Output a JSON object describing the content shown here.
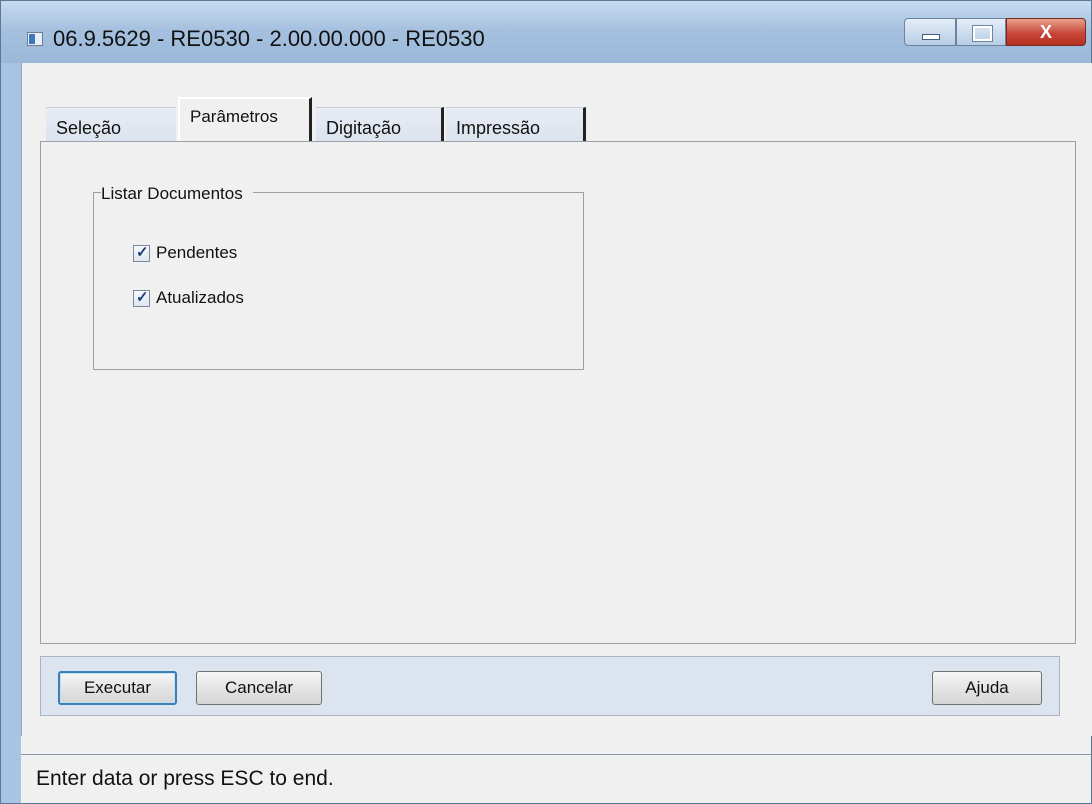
{
  "window": {
    "title": "06.9.5629 - RE0530 - 2.00.00.000 - RE0530",
    "close_glyph": "X"
  },
  "tabs": [
    {
      "label": "Seleção",
      "active": false
    },
    {
      "label": "Parâmetros",
      "active": true
    },
    {
      "label": "Digitação",
      "active": false
    },
    {
      "label": "Impressão",
      "active": false
    }
  ],
  "group": {
    "title": "Listar Documentos",
    "options": [
      {
        "label": "Pendentes",
        "checked": true
      },
      {
        "label": "Atualizados",
        "checked": true
      }
    ]
  },
  "buttons": {
    "execute": "Executar",
    "cancel": "Cancelar",
    "help": "Ajuda"
  },
  "status": {
    "text": "Enter data or press ESC to end."
  }
}
